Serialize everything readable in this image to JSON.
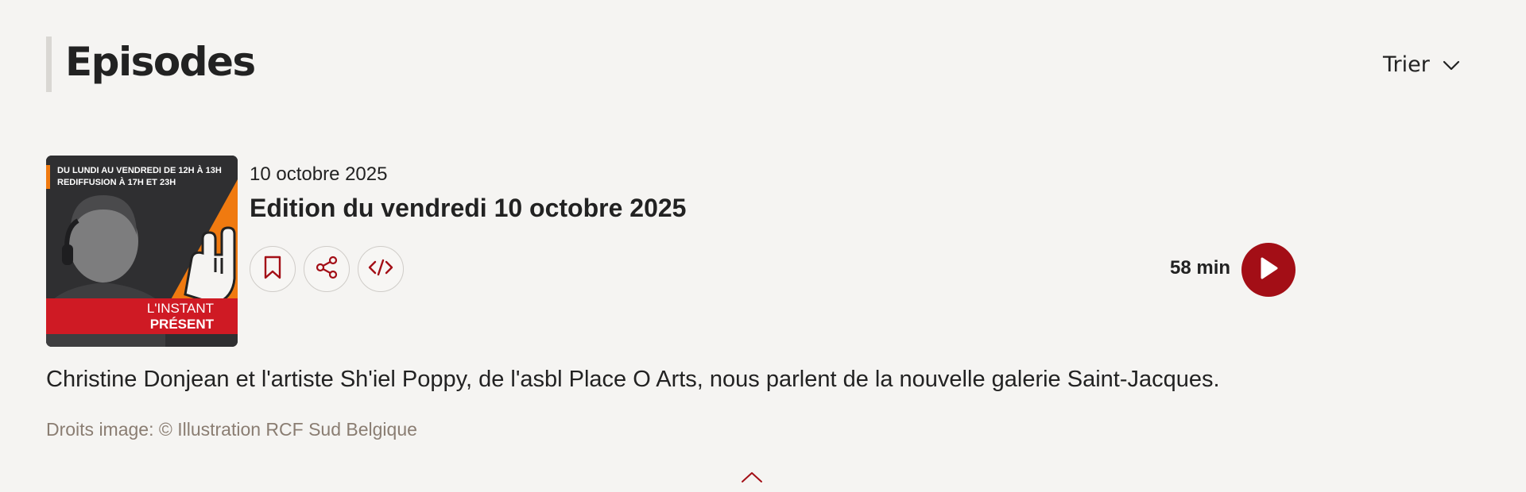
{
  "header": {
    "title": "Episodes",
    "sort_label": "Trier"
  },
  "episode": {
    "date": "10 octobre 2025",
    "title": "Edition du vendredi 10 octobre 2025",
    "duration": "58 min",
    "description": "Christine Donjean et l'artiste Sh'iel Poppy, de l'asbl Place O Arts, nous parlent de la nouvelle galerie Saint-Jacques.",
    "credits": "Droits image: © Illustration RCF Sud Belgique",
    "thumbnail": {
      "line1": "DU LUNDI AU VENDREDI DE 12H À 13H",
      "line2": "REDIFFUSION À 17H ET 23H",
      "brand_line1": "L'INSTANT",
      "brand_line2": "PRÉSENT"
    },
    "actions": [
      "bookmark-icon",
      "share-icon",
      "code-icon"
    ]
  },
  "colors": {
    "accent": "#a30e16",
    "background": "#f5f4f2",
    "credits_text": "#8a7d72",
    "thumb_band": "#cf1a24",
    "thumb_triangle": "#f07a10"
  }
}
